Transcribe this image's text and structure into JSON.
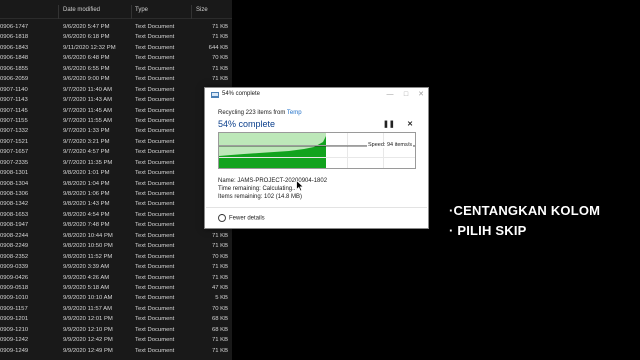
{
  "explorer": {
    "columns": {
      "date": "Date modified",
      "type": "Type",
      "size": "Size"
    },
    "rows": [
      {
        "name": "0906-1747",
        "date": "9/6/2020 5:47 PM",
        "type": "Text Document",
        "size": "71 KB"
      },
      {
        "name": "0906-1818",
        "date": "9/6/2020 6:18 PM",
        "type": "Text Document",
        "size": "71 KB"
      },
      {
        "name": "0906-1843",
        "date": "9/11/2020 12:32 PM",
        "type": "Text Document",
        "size": "644 KB"
      },
      {
        "name": "0906-1848",
        "date": "9/6/2020 6:48 PM",
        "type": "Text Document",
        "size": "70 KB"
      },
      {
        "name": "0906-1855",
        "date": "9/6/2020 6:55 PM",
        "type": "Text Document",
        "size": "71 KB"
      },
      {
        "name": "0906-2059",
        "date": "9/6/2020 9:00 PM",
        "type": "Text Document",
        "size": "71 KB"
      },
      {
        "name": "0907-1140",
        "date": "9/7/2020 11:40 AM",
        "type": "Text Document",
        "size": ""
      },
      {
        "name": "0907-1143",
        "date": "9/7/2020 11:43 AM",
        "type": "Text Document",
        "size": ""
      },
      {
        "name": "0907-1145",
        "date": "9/7/2020 11:45 AM",
        "type": "Text Document",
        "size": ""
      },
      {
        "name": "0907-1155",
        "date": "9/7/2020 11:55 AM",
        "type": "Text Document",
        "size": ""
      },
      {
        "name": "0907-1332",
        "date": "9/7/2020 1:33 PM",
        "type": "Text Document",
        "size": ""
      },
      {
        "name": "0907-1521",
        "date": "9/7/2020 3:21 PM",
        "type": "Text Document",
        "size": ""
      },
      {
        "name": "0907-1657",
        "date": "9/7/2020 4:57 PM",
        "type": "Text Document",
        "size": ""
      },
      {
        "name": "0907-2335",
        "date": "9/7/2020 11:35 PM",
        "type": "Text Document",
        "size": ""
      },
      {
        "name": "0908-1301",
        "date": "9/8/2020 1:01 PM",
        "type": "Text Document",
        "size": ""
      },
      {
        "name": "0908-1304",
        "date": "9/8/2020 1:04 PM",
        "type": "Text Document",
        "size": ""
      },
      {
        "name": "0908-1306",
        "date": "9/8/2020 1:06 PM",
        "type": "Text Document",
        "size": ""
      },
      {
        "name": "0908-1342",
        "date": "9/8/2020 1:43 PM",
        "type": "Text Document",
        "size": ""
      },
      {
        "name": "0908-1653",
        "date": "9/8/2020 4:54 PM",
        "type": "Text Document",
        "size": ""
      },
      {
        "name": "0908-1947",
        "date": "9/8/2020 7:48 PM",
        "type": "Text Document",
        "size": ""
      },
      {
        "name": "0908-2244",
        "date": "9/8/2020 10:44 PM",
        "type": "Text Document",
        "size": "71 KB"
      },
      {
        "name": "0908-2249",
        "date": "9/8/2020 10:50 PM",
        "type": "Text Document",
        "size": "71 KB"
      },
      {
        "name": "0908-2352",
        "date": "9/8/2020 11:52 PM",
        "type": "Text Document",
        "size": "70 KB"
      },
      {
        "name": "0909-0339",
        "date": "9/9/2020 3:39 AM",
        "type": "Text Document",
        "size": "71 KB"
      },
      {
        "name": "0909-0426",
        "date": "9/9/2020 4:26 AM",
        "type": "Text Document",
        "size": "71 KB"
      },
      {
        "name": "0909-0518",
        "date": "9/9/2020 5:18 AM",
        "type": "Text Document",
        "size": "47 KB"
      },
      {
        "name": "0909-1010",
        "date": "9/9/2020 10:10 AM",
        "type": "Text Document",
        "size": "5 KB"
      },
      {
        "name": "0909-1157",
        "date": "9/9/2020 11:57 AM",
        "type": "Text Document",
        "size": "70 KB"
      },
      {
        "name": "0909-1201",
        "date": "9/9/2020 12:01 PM",
        "type": "Text Document",
        "size": "68 KB"
      },
      {
        "name": "0909-1210",
        "date": "9/9/2020 12:10 PM",
        "type": "Text Document",
        "size": "68 KB"
      },
      {
        "name": "0909-1242",
        "date": "9/9/2020 12:42 PM",
        "type": "Text Document",
        "size": "71 KB"
      },
      {
        "name": "0909-1249",
        "date": "9/9/2020 12:49 PM",
        "type": "Text Document",
        "size": "71 KB"
      }
    ]
  },
  "dialog": {
    "title": "54% complete",
    "recycling_prefix": "Recycling 223 items from ",
    "recycling_source": "Temp",
    "percent_label": "54% complete",
    "progress": 0.54,
    "speed": "Speed: 94 items/s",
    "name_line": "Name: JAMS-PROJECT-20200904-1802",
    "time_line": "Time remaining: Calculating...",
    "items_line": "Items remaining: 102 (14.8 MB)",
    "fewer_details": "Fewer details",
    "minimize": "—",
    "maximize": "□",
    "close": "✕",
    "pause_icon": "❚❚",
    "cancel_icon": "✕",
    "accent_color": "#06b025"
  },
  "captions": {
    "line1": "·CENTANGKAN KOLOM",
    "line2": "· PILIH SKIP"
  }
}
